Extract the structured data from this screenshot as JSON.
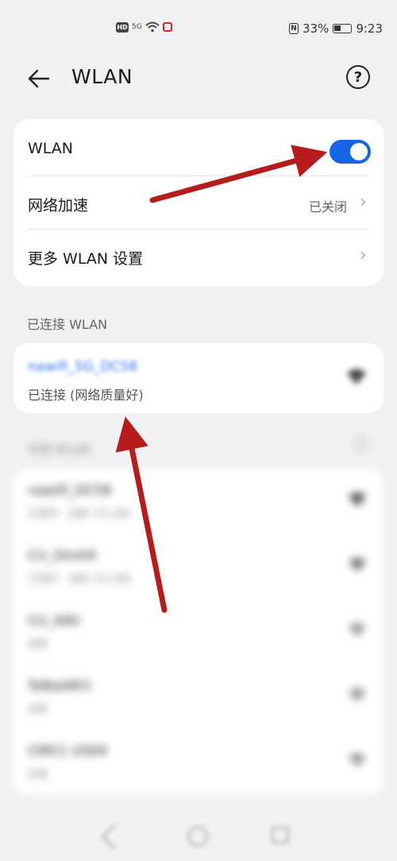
{
  "status_bar": {
    "hd": "HD",
    "signal": "5G",
    "battery": "33%",
    "time": "9:23"
  },
  "header": {
    "title": "WLAN"
  },
  "settings": {
    "wlan_label": "WLAN",
    "wlan_on": true,
    "accel_label": "网络加速",
    "accel_value": "已关闭",
    "more_label": "更多 WLAN 设置"
  },
  "connected": {
    "section_title": "已连接 WLAN",
    "name": "nawifi_5G_DC58",
    "status": "已连接 (网络质量好)"
  },
  "available": {
    "section_title": "可用 WLAN",
    "items": [
      {
        "name": "nawifi_DC58",
        "sub": "已保存 · 加密 (可上网)"
      },
      {
        "name": "CU_DmH4",
        "sub": "已保存 · 加密 (可上网)"
      },
      {
        "name": "CU_AIKr",
        "sub": "加密"
      },
      {
        "name": "TeBaiAR3",
        "sub": "加密"
      },
      {
        "name": "CMCC-2009",
        "sub": "加密"
      }
    ]
  },
  "colors": {
    "accent": "#1565e6",
    "annotation": "#b71c1c"
  }
}
